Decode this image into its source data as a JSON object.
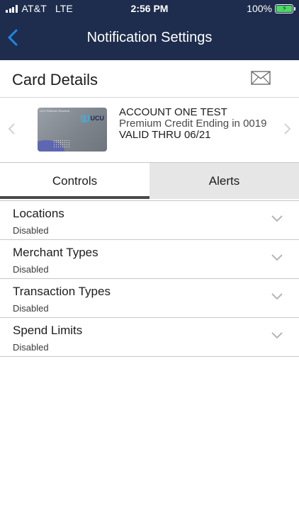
{
  "status_bar": {
    "carrier": "AT&T",
    "network": "LTE",
    "time": "2:56 PM",
    "battery": "100%",
    "battery_color": "#4cd964"
  },
  "nav": {
    "title": "Notification Settings",
    "back_icon": "chevron-left-icon",
    "accent_color": "#1e88e5",
    "bar_color": "#1e2d4d"
  },
  "card_header": {
    "title": "Card Details",
    "mail_icon": "envelope-icon"
  },
  "card": {
    "program": "UCU Platinum Rewards",
    "logo_text": "UCU",
    "name": "ACCOUNT ONE TEST",
    "description": "Premium Credit Ending in 0019",
    "valid": "VALID THRU 06/21"
  },
  "tabs": [
    {
      "label": "Controls",
      "active": true
    },
    {
      "label": "Alerts",
      "active": false
    }
  ],
  "controls": [
    {
      "label": "Locations",
      "status": "Disabled"
    },
    {
      "label": "Merchant Types",
      "status": "Disabled"
    },
    {
      "label": "Transaction Types",
      "status": "Disabled"
    },
    {
      "label": "Spend Limits",
      "status": "Disabled"
    }
  ]
}
